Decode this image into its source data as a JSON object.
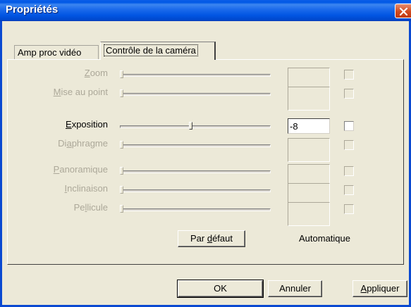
{
  "window": {
    "title": "Propriétés",
    "close_icon": "close-x-icon"
  },
  "tabs": [
    {
      "label": "Amp proc vidéo",
      "active": false
    },
    {
      "label": "Contrôle de la caméra",
      "active": true
    }
  ],
  "controls": [
    {
      "label_prefix": "",
      "mnemonic": "Z",
      "label_rest": "oom",
      "enabled": false,
      "value": "",
      "slider_fraction": 0.0,
      "auto_checked": false
    },
    {
      "label_prefix": "",
      "mnemonic": "M",
      "label_rest": "ise au point",
      "enabled": false,
      "value": "",
      "slider_fraction": 0.0,
      "auto_checked": false
    },
    {
      "label_prefix": "",
      "mnemonic": "E",
      "label_rest": "xposition",
      "enabled": true,
      "value": "-8",
      "slider_fraction": 0.47,
      "auto_checked": false
    },
    {
      "label_prefix": "Di",
      "mnemonic": "a",
      "label_rest": "phragme",
      "enabled": false,
      "value": "",
      "slider_fraction": 0.0,
      "auto_checked": false
    },
    {
      "label_prefix": "",
      "mnemonic": "P",
      "label_rest": "anoramique",
      "enabled": false,
      "value": "",
      "slider_fraction": 0.0,
      "auto_checked": false
    },
    {
      "label_prefix": "",
      "mnemonic": "I",
      "label_rest": "nclinaison",
      "enabled": false,
      "value": "",
      "slider_fraction": 0.0,
      "auto_checked": false
    },
    {
      "label_prefix": "Pe",
      "mnemonic": "l",
      "label_rest": "licule",
      "enabled": false,
      "value": "",
      "slider_fraction": 0.0,
      "auto_checked": false
    }
  ],
  "default_button": {
    "prefix": "Par ",
    "mnemonic": "d",
    "rest": "éfaut"
  },
  "auto_label": "Automatique",
  "buttons": {
    "ok": "OK",
    "cancel": "Annuler",
    "apply_mnemonic": "A",
    "apply_rest": "ppliquer"
  }
}
